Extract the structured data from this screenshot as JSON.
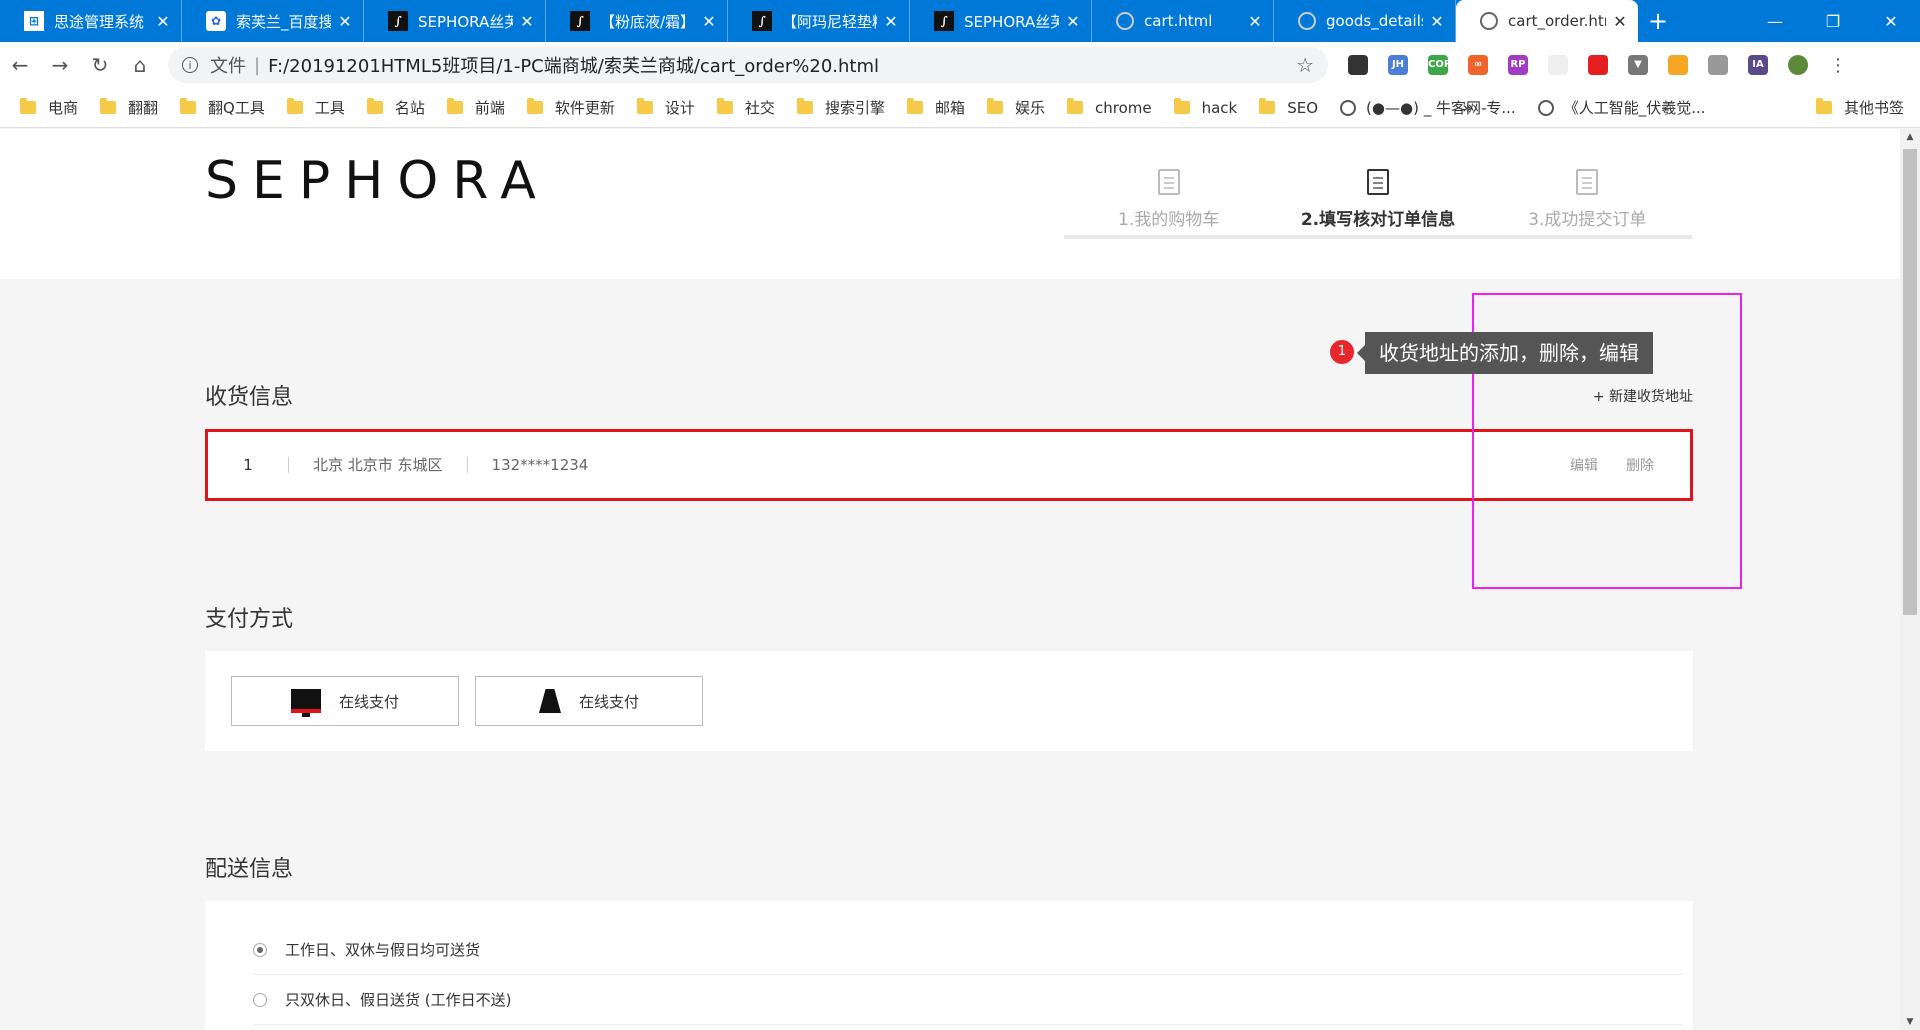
{
  "browser": {
    "tabs": [
      {
        "title": "思途管理系统",
        "icon": "windows-icon",
        "active": false
      },
      {
        "title": "索芙兰_百度搜",
        "icon": "baidu-paw-icon",
        "active": false
      },
      {
        "title": "SEPHORA丝芙",
        "icon": "sephora-icon",
        "active": false
      },
      {
        "title": "【粉底液/霜】",
        "icon": "sephora-icon",
        "active": false
      },
      {
        "title": "【阿玛尼轻垫精",
        "icon": "sephora-icon",
        "active": false
      },
      {
        "title": "SEPHORA丝芙",
        "icon": "sephora-icon",
        "active": false
      },
      {
        "title": "cart.html",
        "icon": "globe-icon",
        "active": false
      },
      {
        "title": "goods_details",
        "icon": "globe-icon",
        "active": false
      },
      {
        "title": "cart_order.htm",
        "icon": "globe-icon",
        "active": true
      }
    ],
    "close_glyph": "✕",
    "new_tab_glyph": "+",
    "address": {
      "scheme": "文件",
      "separator": "|",
      "url": "F:/20191201HTML5班项目/1-PC端商城/索芙兰商城/cart_order%20.html"
    },
    "bookmarks": [
      {
        "label": "电商",
        "type": "folder"
      },
      {
        "label": "翻翻",
        "type": "folder"
      },
      {
        "label": "翻Q工具",
        "type": "folder"
      },
      {
        "label": "工具",
        "type": "folder"
      },
      {
        "label": "名站",
        "type": "folder"
      },
      {
        "label": "前端",
        "type": "folder"
      },
      {
        "label": "软件更新",
        "type": "folder"
      },
      {
        "label": "设计",
        "type": "folder"
      },
      {
        "label": "社交",
        "type": "folder"
      },
      {
        "label": "搜索引擎",
        "type": "folder"
      },
      {
        "label": "邮箱",
        "type": "folder"
      },
      {
        "label": "娱乐",
        "type": "folder"
      },
      {
        "label": "chrome",
        "type": "folder"
      },
      {
        "label": "hack",
        "type": "folder"
      },
      {
        "label": "SEO",
        "type": "folder"
      },
      {
        "label": "(●—●) _ 牛客网-专...",
        "type": "page"
      },
      {
        "label": "《人工智能_伏羲觉...",
        "type": "page"
      }
    ],
    "bookmarks_more": "»",
    "other_bookmarks": "其他书签",
    "extensions": [
      {
        "name": "cloud-extension-icon",
        "color": "#333333",
        "text": ""
      },
      {
        "name": "jh-extension-icon",
        "color": "#4a7fd8",
        "text": "JH"
      },
      {
        "name": "cors-extension-icon",
        "color": "#39a845",
        "text": "CORS"
      },
      {
        "name": "infinity-extension-icon",
        "color": "#f0642c",
        "text": "∞"
      },
      {
        "name": "rp-extension-icon",
        "color": "#a23bc1",
        "text": "RP"
      },
      {
        "name": "blank-extension-icon",
        "color": "#eeeeee",
        "text": ""
      },
      {
        "name": "adblock-extension-icon",
        "color": "#e41f1f",
        "text": ""
      },
      {
        "name": "vue-extension-icon",
        "color": "#777777",
        "text": "▼"
      },
      {
        "name": "color-extension-icon",
        "color": "#f5a623",
        "text": ""
      },
      {
        "name": "share-extension-icon",
        "color": "#999999",
        "text": ""
      },
      {
        "name": "ia-extension-icon",
        "color": "#5a4a8a",
        "text": "IA"
      }
    ]
  },
  "page": {
    "logo": "SEPHORA",
    "steps": [
      {
        "label": "1.我的购物车",
        "active": false
      },
      {
        "label": "2.填写核对订单信息",
        "active": true
      },
      {
        "label": "3.成功提交订单",
        "active": false
      }
    ],
    "shipping_info": {
      "title": "收货信息",
      "add_link": "+ 新建收货地址",
      "address": {
        "index": "1",
        "region": "北京 北京市 东城区",
        "phone": "132****1234",
        "edit": "编辑",
        "delete": "删除"
      }
    },
    "annotation": {
      "number": "1",
      "text": "收货地址的添加，删除，编辑"
    },
    "payment": {
      "title": "支付方式",
      "options": [
        {
          "label": "在线支付",
          "icon": "monitor-icon"
        },
        {
          "label": "在线支付",
          "icon": "figure-icon"
        }
      ]
    },
    "delivery": {
      "title": "配送信息",
      "options": [
        {
          "label": "工作日、双休与假日均可送货",
          "selected": true
        },
        {
          "label": "只双休日、假日送货 (工作日不送)",
          "selected": false
        }
      ]
    }
  }
}
